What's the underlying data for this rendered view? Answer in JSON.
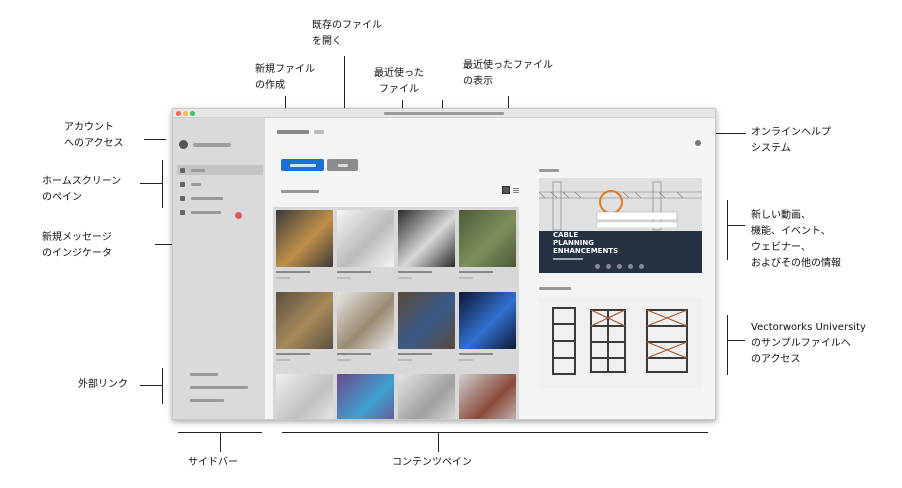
{
  "callouts": {
    "open_existing": "既存のファイル\nを開く",
    "new_file": "新規ファイル\nの作成",
    "recent_files": "最近使った\nファイル",
    "recent_view": "最近使ったファイル\nの表示",
    "account": "アカウント\nへのアクセス",
    "home_pane": "ホームスクリーン\nのペイン",
    "new_message": "新規メッセージ\nのインジケータ",
    "external_links": "外部リンク",
    "online_help": "オンラインヘルプ\nシステム",
    "news": "新しい動画、\n機能、イベント、\nウェビナー、\nおよびその他の情報",
    "university": "Vectorworks University\nのサンプルファイルへ\nのアクセス",
    "sidebar": "サイドバー",
    "content_pane": "コンテンツペイン"
  },
  "colors": {
    "primary_button": "#1a6fd6",
    "secondary_button": "#8c8c8c",
    "message_badge": "#e05a5a"
  },
  "video": {
    "title": "CABLE PLANNING ENHANCEMENTS"
  },
  "thumbnails": [
    {
      "fill": "#3a3a3a",
      "accent": "#c0904a"
    },
    {
      "fill": "#f5f5f5",
      "accent": "#bbbbbb"
    },
    {
      "fill": "#2a2a2a",
      "accent": "#d8d8d8"
    },
    {
      "fill": "#4c5a3a",
      "accent": "#7e8f5a"
    },
    {
      "fill": "#5a5040",
      "accent": "#a88a5a"
    },
    {
      "fill": "#e8e8e8",
      "accent": "#9a8a70"
    },
    {
      "fill": "#5a4a3a",
      "accent": "#3a5a8a"
    },
    {
      "fill": "#101830",
      "accent": "#3070d0"
    },
    {
      "fill": "#f0f0f0",
      "accent": "#c0c0c0"
    },
    {
      "fill": "#6a4a8a",
      "accent": "#40a0d0"
    },
    {
      "fill": "#e4e4e4",
      "accent": "#a0a0a0"
    },
    {
      "fill": "#d0d0d0",
      "accent": "#8a4a3a"
    }
  ]
}
